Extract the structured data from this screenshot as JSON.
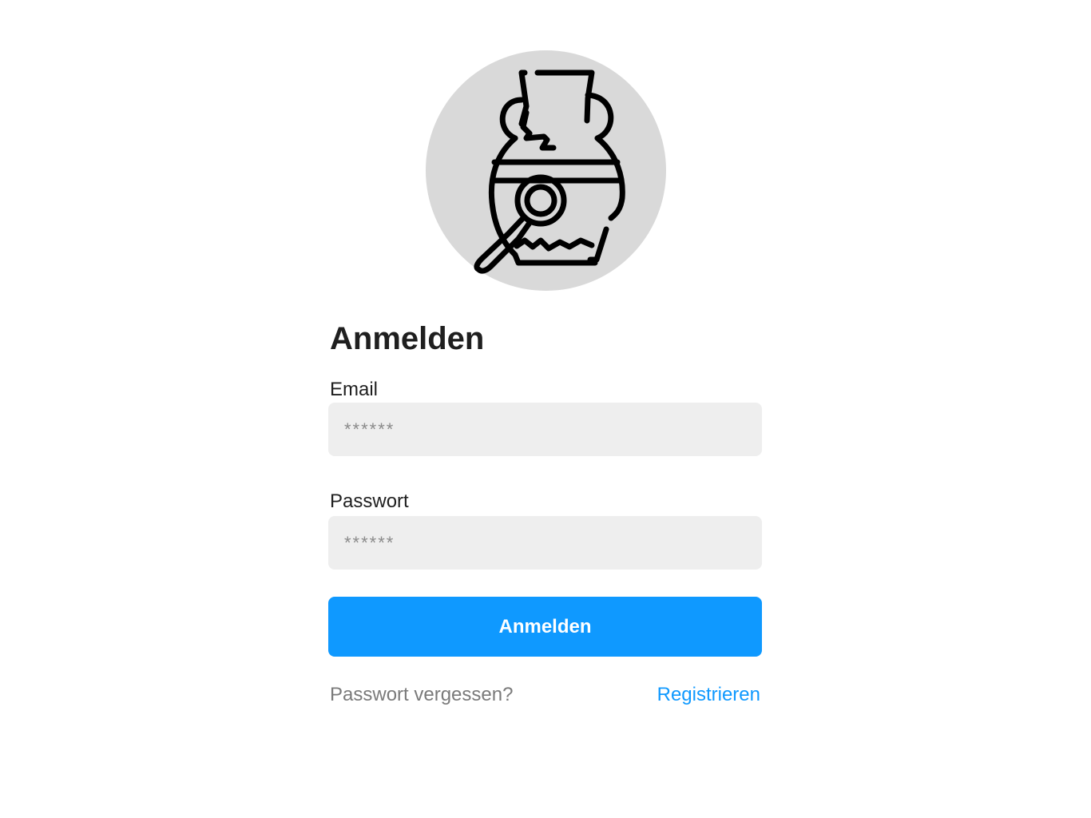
{
  "logo": {
    "icon": "vase-magnifier-icon",
    "circle_color": "#d9d9d9"
  },
  "form": {
    "title": "Anmelden",
    "email": {
      "label": "Email",
      "placeholder": "******",
      "value": ""
    },
    "password": {
      "label": "Passwort",
      "placeholder": "******",
      "value": ""
    },
    "submit_label": "Anmelden",
    "forgot_label": "Passwort vergessen?",
    "register_label": "Registrieren"
  },
  "colors": {
    "accent": "#0f99ff",
    "input_bg": "#eeeeee",
    "muted_text": "#7a7a7a",
    "text": "#1f1f1f"
  }
}
